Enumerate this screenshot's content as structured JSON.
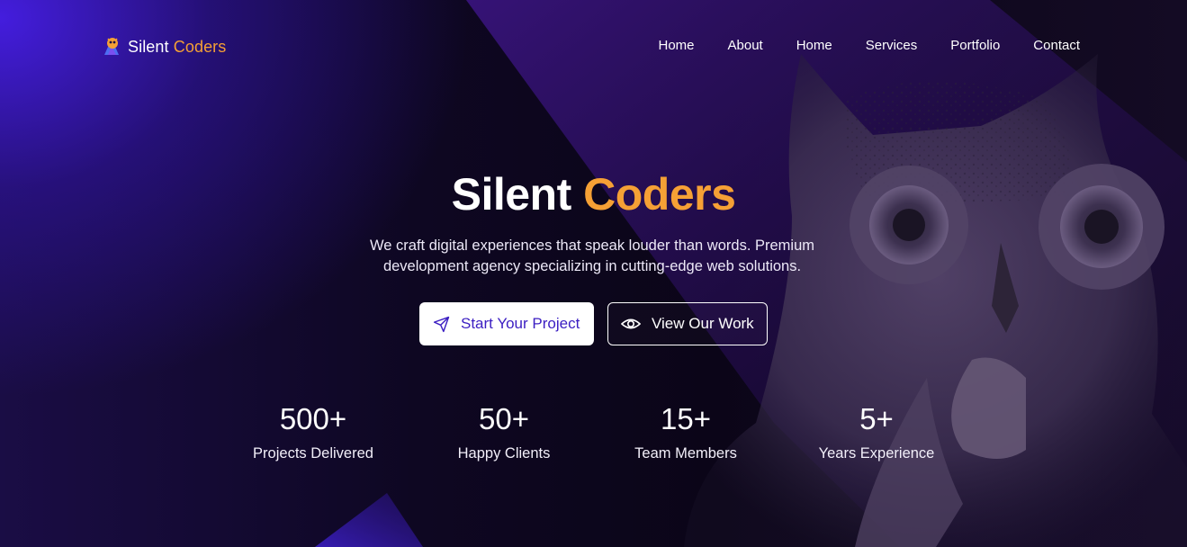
{
  "brand": {
    "name_first": "Silent",
    "name_accent": "Coders",
    "icon": "owl-logo-icon"
  },
  "nav": {
    "items": [
      {
        "label": "Home"
      },
      {
        "label": "About"
      },
      {
        "label": "Home"
      },
      {
        "label": "Services"
      },
      {
        "label": "Portfolio"
      },
      {
        "label": "Contact"
      }
    ]
  },
  "hero": {
    "title_first": "Silent",
    "title_accent": "Coders",
    "subtitle_line1": "We craft digital experiences that speak louder than words. Premium",
    "subtitle_line2": "development agency specializing in cutting-edge web solutions.",
    "primary_button": {
      "label": "Start Your Project",
      "icon": "send-icon"
    },
    "secondary_button": {
      "label": "View Our Work",
      "icon": "eye-icon"
    }
  },
  "stats": [
    {
      "value": "500+",
      "label": "Projects Delivered"
    },
    {
      "value": "50+",
      "label": "Happy Clients"
    },
    {
      "value": "15+",
      "label": "Team Members"
    },
    {
      "value": "5+",
      "label": "Years Experience"
    }
  ],
  "colors": {
    "accent": "#f5a035",
    "primary": "#3b1ec2",
    "background": "#0d061c",
    "glow": "#4a1ee6"
  }
}
